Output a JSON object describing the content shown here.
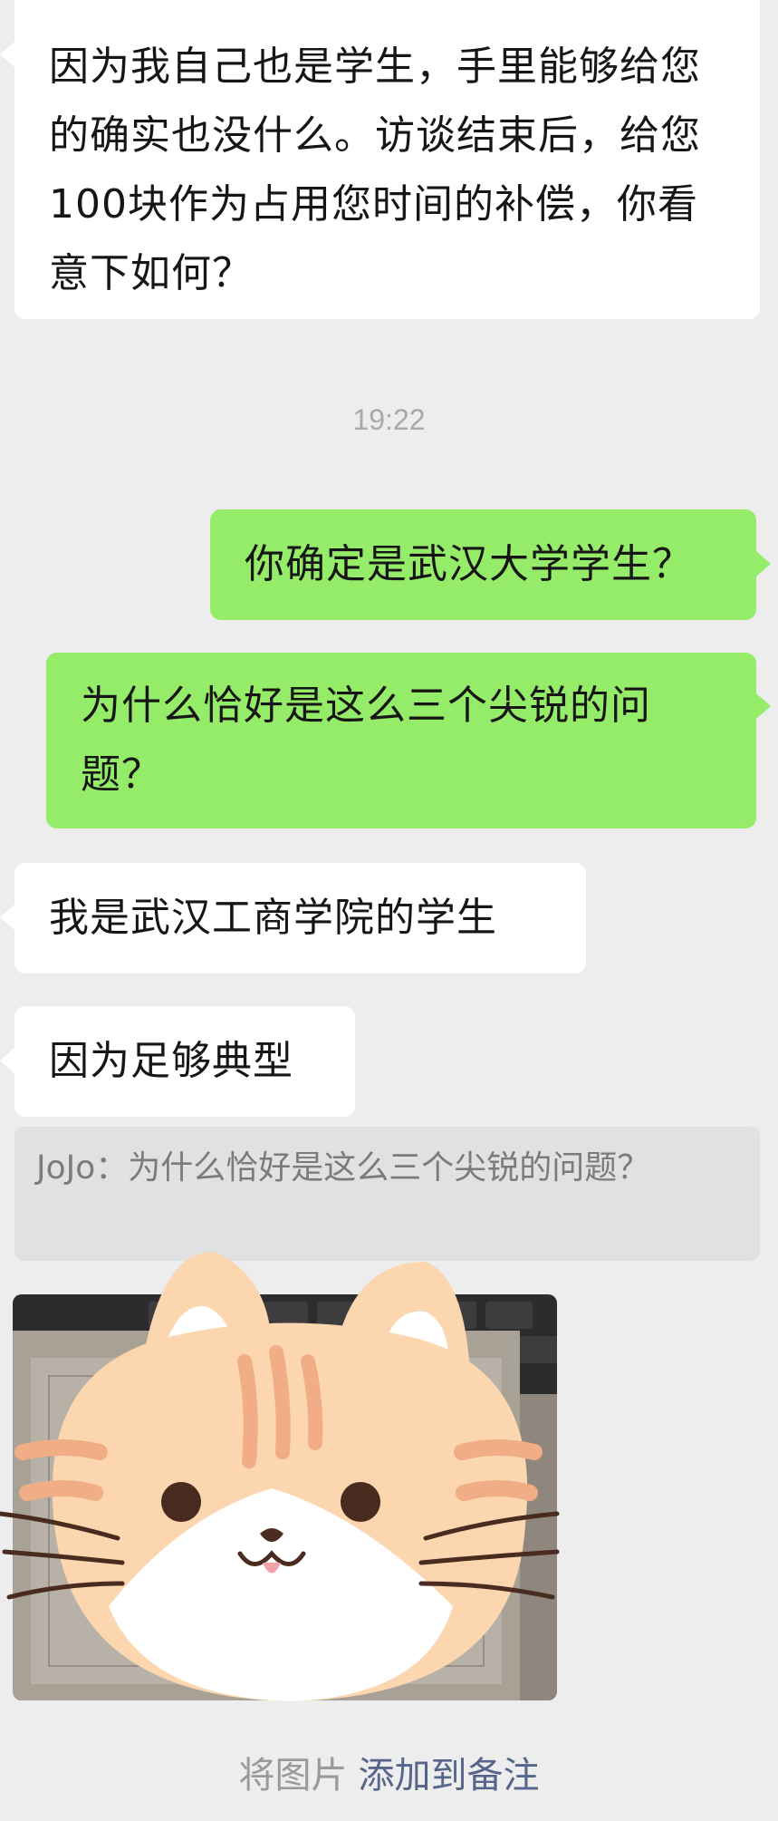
{
  "messages": [
    {
      "side": "in",
      "text": "因为我自己也是学生，手里能够给您的确实也没什么。访谈结束后，给您100块作为占用您时间的补偿，你看意下如何？"
    },
    {
      "side": "out",
      "text": "你确定是武汉大学学生？"
    },
    {
      "side": "out",
      "text": "为什么恰好是这么三个尖锐的问题？"
    },
    {
      "side": "in",
      "text": "我是武汉工商学院的学生"
    },
    {
      "side": "in",
      "text": "因为足够典型"
    }
  ],
  "timestamp": "19:22",
  "quote": {
    "text": "JoJo：为什么恰好是这么三个尖锐的问题？"
  },
  "footer": {
    "prefix": "将图片",
    "link": "添加到备注"
  },
  "colors": {
    "background": "#ededed",
    "incoming": "#ffffff",
    "outgoing": "#95ec69",
    "link": "#56658a"
  },
  "image": {
    "description_icon": "cat-face-sticker-over-laptop-photo"
  }
}
